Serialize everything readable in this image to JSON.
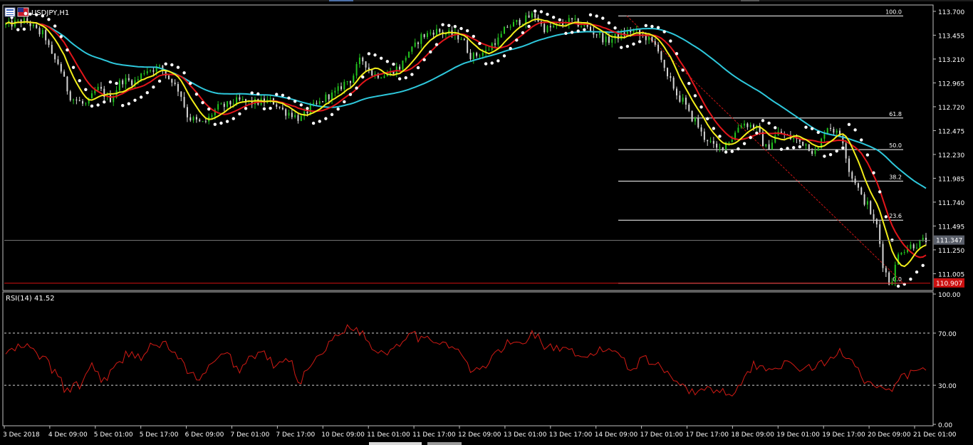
{
  "window": {
    "symbol_title": "USDJPY,H1",
    "indicator_title": "RSI(14) 41.52"
  },
  "colors": {
    "background": "#000000",
    "frame": "#c0c0c0",
    "text": "#ffffff",
    "bull_candle": "#22c41f",
    "bear_candle": "#d6d6d6",
    "sma_fast": "#f2ee1a",
    "sma_mid": "#e3151a",
    "sma_slow": "#2ec8dc",
    "sar": "#ffffff",
    "rsi": "#d11a14",
    "bid_line": "#7a7a7a",
    "low_line": "#d31010",
    "fib": "#ffffff",
    "fib_diag": "#c81414",
    "current_tag": "#5a5f6a",
    "low_tag": "#cc1010"
  },
  "chart_data": [
    {
      "type": "candlestick",
      "symbol": "USDJPY",
      "timeframe": "H1",
      "ylim": [
        110.847,
        113.758
      ],
      "x_ticks": [
        "3 Dec 2018",
        "4 Dec 09:00",
        "5 Dec 01:00",
        "5 Dec 17:00",
        "6 Dec 09:00",
        "7 Dec 01:00",
        "7 Dec 17:00",
        "10 Dec 09:00",
        "11 Dec 01:00",
        "11 Dec 17:00",
        "12 Dec 09:00",
        "13 Dec 01:00",
        "13 Dec 17:00",
        "14 Dec 09:00",
        "17 Dec 01:00",
        "17 Dec 17:00",
        "18 Dec 09:00",
        "19 Dec 01:00",
        "19 Dec 17:00",
        "20 Dec 09:00",
        "21 Dec 01:00"
      ],
      "y_ticks": [
        "113.700",
        "113.455",
        "113.210",
        "112.965",
        "112.720",
        "112.475",
        "112.230",
        "111.985",
        "111.740",
        "111.495",
        "111.250",
        "111.005"
      ],
      "price_keypoints": [
        [
          0,
          113.56
        ],
        [
          3,
          113.6
        ],
        [
          6,
          113.47
        ],
        [
          8,
          113.2
        ],
        [
          11,
          112.8
        ],
        [
          13,
          112.74
        ],
        [
          15,
          112.9
        ],
        [
          17,
          112.8
        ],
        [
          19,
          112.99
        ],
        [
          21,
          112.98
        ],
        [
          23,
          113.1
        ],
        [
          25,
          113.12
        ],
        [
          27,
          113.0
        ],
        [
          28,
          112.9
        ],
        [
          30,
          112.6
        ],
        [
          32,
          112.55
        ],
        [
          35,
          112.72
        ],
        [
          38,
          112.78
        ],
        [
          40,
          112.76
        ],
        [
          43,
          112.78
        ],
        [
          46,
          112.66
        ],
        [
          48,
          112.6
        ],
        [
          50,
          112.72
        ],
        [
          53,
          112.84
        ],
        [
          56,
          112.99
        ],
        [
          58,
          113.2
        ],
        [
          60,
          113.05
        ],
        [
          62,
          113.05
        ],
        [
          64,
          113.12
        ],
        [
          66,
          113.3
        ],
        [
          68,
          113.45
        ],
        [
          70,
          113.5
        ],
        [
          72,
          113.47
        ],
        [
          74,
          113.44
        ],
        [
          76,
          113.24
        ],
        [
          78,
          113.28
        ],
        [
          80,
          113.4
        ],
        [
          82,
          113.55
        ],
        [
          84,
          113.6
        ],
        [
          86,
          113.66
        ],
        [
          88,
          113.52
        ],
        [
          90,
          113.55
        ],
        [
          92,
          113.6
        ],
        [
          94,
          113.56
        ],
        [
          96,
          113.48
        ],
        [
          98,
          113.4
        ],
        [
          100,
          113.45
        ],
        [
          102,
          113.5
        ],
        [
          104,
          113.44
        ],
        [
          106,
          113.35
        ],
        [
          108,
          113.0
        ],
        [
          110,
          112.8
        ],
        [
          112,
          112.6
        ],
        [
          114,
          112.4
        ],
        [
          116,
          112.28
        ],
        [
          118,
          112.38
        ],
        [
          120,
          112.55
        ],
        [
          122,
          112.52
        ],
        [
          124,
          112.3
        ],
        [
          126,
          112.45
        ],
        [
          128,
          112.4
        ],
        [
          130,
          112.35
        ],
        [
          132,
          112.25
        ],
        [
          134,
          112.52
        ],
        [
          136,
          112.43
        ],
        [
          138,
          111.99
        ],
        [
          140,
          111.75
        ],
        [
          142,
          111.5
        ],
        [
          143,
          111.1
        ],
        [
          144,
          110.91
        ],
        [
          146,
          111.25
        ],
        [
          148,
          111.3
        ],
        [
          150,
          111.35
        ]
      ],
      "overlays": [
        {
          "name": "",
          "kind": "sma",
          "period": 8,
          "color": "yellow"
        },
        {
          "name": "",
          "kind": "sma",
          "period": 14,
          "color": "red"
        },
        {
          "name": "",
          "kind": "sma",
          "period": 50,
          "color": "cyan"
        },
        {
          "name": "",
          "kind": "parabolic_sar",
          "color": "white"
        }
      ],
      "fibonacci": {
        "high": 113.653,
        "low": 110.907,
        "levels": [
          {
            "label": "100.0",
            "price": 113.653
          },
          {
            "label": "61.8",
            "price": 112.604
          },
          {
            "label": "50.0",
            "price": 112.28
          },
          {
            "label": "38.2",
            "price": 111.956
          },
          {
            "label": "23.6",
            "price": 111.555
          },
          {
            "label": "0.0",
            "price": 110.907
          }
        ]
      },
      "current_price_label": "111.347",
      "current_price": 111.347,
      "low_price_label": "110.907",
      "low_price": 110.907
    },
    {
      "type": "line",
      "indicator": "RSI",
      "period": 14,
      "ylim": [
        0,
        100
      ],
      "y_ticks": [
        "100.00",
        "70.00",
        "30.00",
        "0.00"
      ],
      "levels": [
        70,
        30
      ],
      "current_value": 41.52,
      "keypoints": [
        [
          0,
          55
        ],
        [
          3,
          60
        ],
        [
          6,
          52
        ],
        [
          8,
          40
        ],
        [
          10,
          26
        ],
        [
          12,
          30
        ],
        [
          14,
          45
        ],
        [
          16,
          34
        ],
        [
          18,
          44
        ],
        [
          20,
          55
        ],
        [
          22,
          52
        ],
        [
          24,
          60
        ],
        [
          26,
          62
        ],
        [
          28,
          52
        ],
        [
          30,
          38
        ],
        [
          32,
          36
        ],
        [
          34,
          48
        ],
        [
          36,
          54
        ],
        [
          38,
          42
        ],
        [
          40,
          52
        ],
        [
          42,
          55
        ],
        [
          44,
          44
        ],
        [
          46,
          50
        ],
        [
          48,
          34
        ],
        [
          50,
          48
        ],
        [
          52,
          58
        ],
        [
          54,
          68
        ],
        [
          56,
          76
        ],
        [
          58,
          70
        ],
        [
          60,
          58
        ],
        [
          62,
          55
        ],
        [
          64,
          62
        ],
        [
          66,
          72
        ],
        [
          68,
          64
        ],
        [
          70,
          65
        ],
        [
          72,
          62
        ],
        [
          74,
          55
        ],
        [
          76,
          40
        ],
        [
          78,
          44
        ],
        [
          80,
          55
        ],
        [
          82,
          62
        ],
        [
          84,
          62
        ],
        [
          86,
          70
        ],
        [
          88,
          60
        ],
        [
          90,
          58
        ],
        [
          92,
          55
        ],
        [
          94,
          50
        ],
        [
          96,
          55
        ],
        [
          98,
          58
        ],
        [
          100,
          55
        ],
        [
          102,
          42
        ],
        [
          104,
          52
        ],
        [
          106,
          45
        ],
        [
          108,
          40
        ],
        [
          110,
          32
        ],
        [
          112,
          24
        ],
        [
          114,
          28
        ],
        [
          116,
          26
        ],
        [
          118,
          24
        ],
        [
          120,
          32
        ],
        [
          122,
          46
        ],
        [
          124,
          42
        ],
        [
          126,
          46
        ],
        [
          128,
          45
        ],
        [
          130,
          43
        ],
        [
          132,
          44
        ],
        [
          134,
          48
        ],
        [
          136,
          56
        ],
        [
          138,
          50
        ],
        [
          140,
          34
        ],
        [
          142,
          28
        ],
        [
          144,
          24
        ],
        [
          146,
          36
        ],
        [
          148,
          40
        ],
        [
          150,
          41.52
        ]
      ]
    }
  ]
}
